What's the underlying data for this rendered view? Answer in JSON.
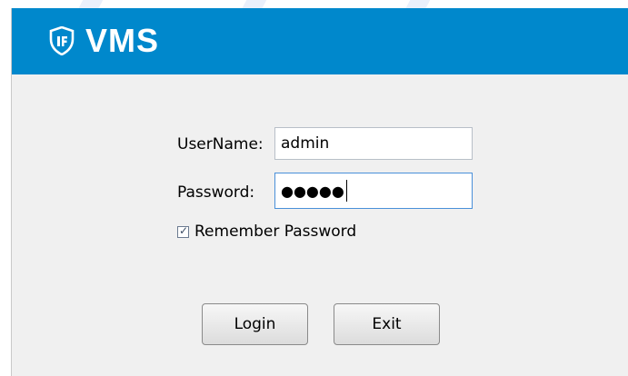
{
  "app": {
    "title": "VMS",
    "brand_color": "#0088cc",
    "logo_icon": "shield-logo-icon"
  },
  "login_form": {
    "username_label": "UserName:",
    "username_value": "admin",
    "password_label": "Password:",
    "password_masked": "●●●●●",
    "remember_checked": true,
    "remember_label": "Remember Password"
  },
  "buttons": {
    "login_label": "Login",
    "exit_label": "Exit"
  }
}
